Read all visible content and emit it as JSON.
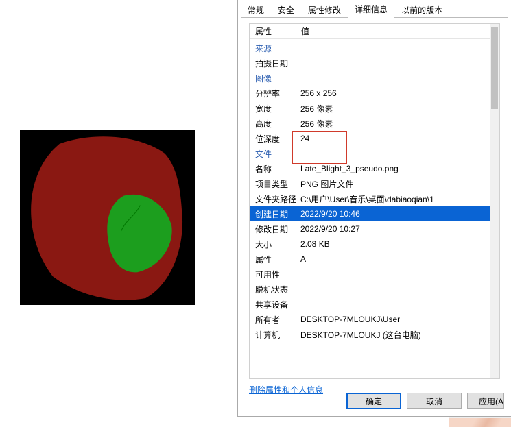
{
  "tabs": {
    "general": "常规",
    "security": "安全",
    "prop_mod": "属性修改",
    "details": "详细信息",
    "previous": "以前的版本"
  },
  "header": {
    "prop": "属性",
    "val": "值"
  },
  "sections": {
    "source": "来源",
    "image": "图像",
    "file": "文件"
  },
  "props": {
    "date_taken": {
      "label": "拍摄日期",
      "value": ""
    },
    "resolution": {
      "label": "分辨率",
      "value": "256 x 256"
    },
    "width": {
      "label": "宽度",
      "value": "256 像素"
    },
    "height": {
      "label": "高度",
      "value": "256 像素"
    },
    "bit_depth": {
      "label": "位深度",
      "value": "24"
    },
    "name": {
      "label": "名称",
      "value": "Late_Blight_3_pseudo.png"
    },
    "item_type": {
      "label": "项目类型",
      "value": "PNG 图片文件"
    },
    "folder_path": {
      "label": "文件夹路径",
      "value": "C:\\用户\\User\\音乐\\桌面\\dabiaoqian\\1"
    },
    "created": {
      "label": "创建日期",
      "value": "2022/9/20 10:46"
    },
    "modified": {
      "label": "修改日期",
      "value": "2022/9/20 10:27"
    },
    "size": {
      "label": "大小",
      "value": "2.08 KB"
    },
    "attributes": {
      "label": "属性",
      "value": "A"
    },
    "availability": {
      "label": "可用性",
      "value": ""
    },
    "offline": {
      "label": "脱机状态",
      "value": ""
    },
    "shared": {
      "label": "共享设备",
      "value": ""
    },
    "owner": {
      "label": "所有者",
      "value": "DESKTOP-7MLOUKJ\\User"
    },
    "computer": {
      "label": "计算机",
      "value": "DESKTOP-7MLOUKJ (这台电脑)"
    }
  },
  "delete_link": "删除属性和个人信息",
  "buttons": {
    "ok": "确定",
    "cancel": "取消",
    "apply": "应用(A"
  }
}
